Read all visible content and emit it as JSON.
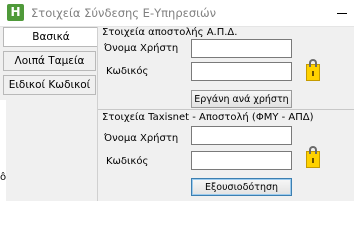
{
  "window": {
    "title": "Στοιχεία Σύνδεσης Ε-Υπηρεσιών",
    "app_icon_letter": "H"
  },
  "tabs": [
    {
      "label": "Βασικά",
      "active": true
    },
    {
      "label": "Λοιπά Ταμεία",
      "active": false
    },
    {
      "label": "Ειδικοί Κωδικοί",
      "active": false
    }
  ],
  "side_text": "ô",
  "apd": {
    "title": "Στοιχεία αποστολής Α.Π.Δ.",
    "username_label": "Όνομα Χρήστη",
    "username_value": "",
    "password_label": "Κωδικός",
    "password_value": "",
    "button_label": "Εργάνη ανά χρήστη"
  },
  "taxisnet": {
    "title": "Στοιχεία Taxisnet - Αποστολή (ΦΜΥ - ΑΠΔ)",
    "username_label": "Όνομα Χρήστη",
    "username_value": "",
    "password_label": "Κωδικός",
    "password_value": "",
    "button_label": "Εξουσιοδότηση"
  },
  "icons": {
    "lock": "lock-icon",
    "minimize": "minimize-icon"
  }
}
